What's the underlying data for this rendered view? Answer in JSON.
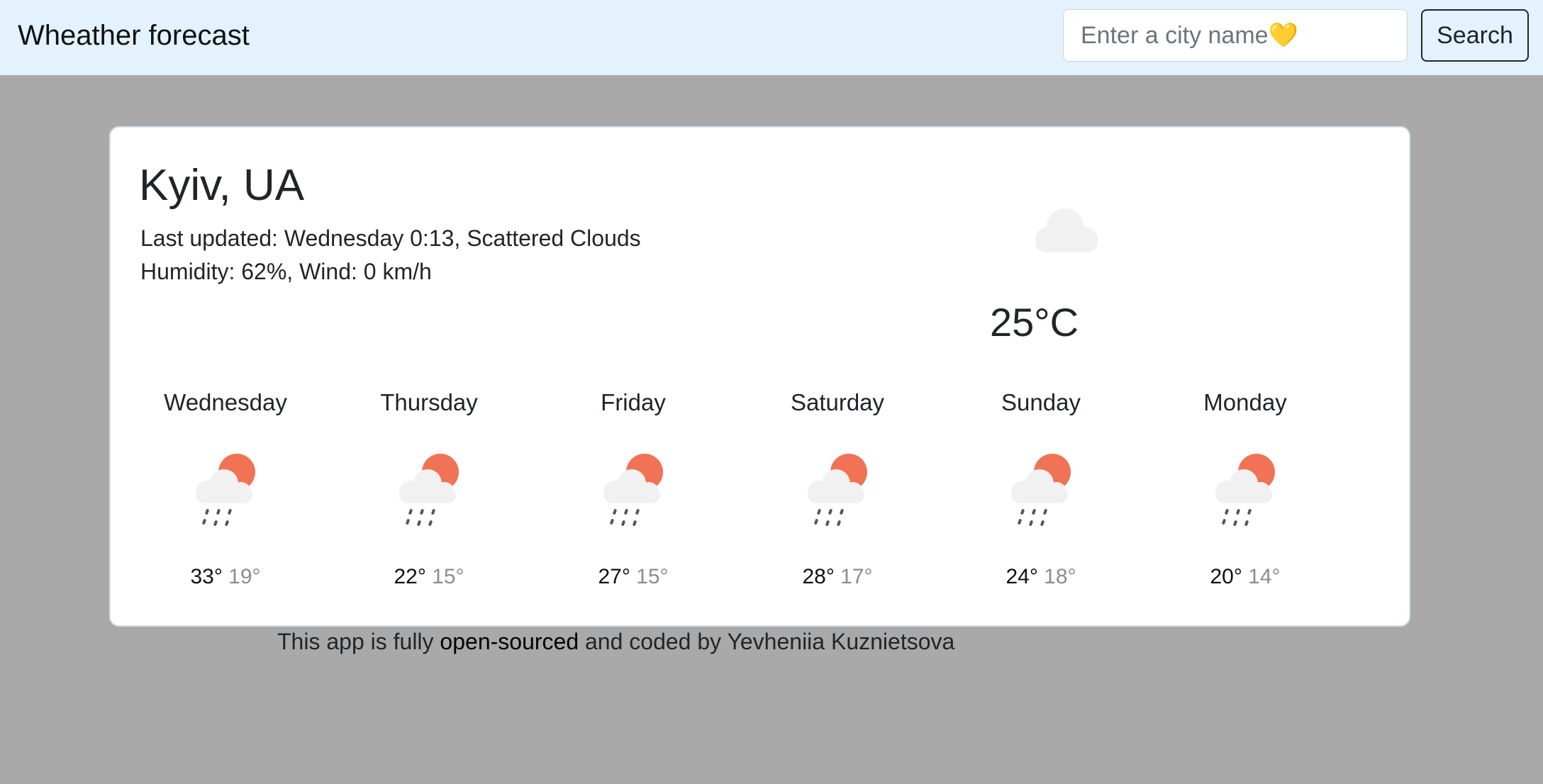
{
  "navbar": {
    "brand": "Wheather forecast",
    "search_placeholder": "Enter a city name💛",
    "search_value": "",
    "search_button": "Search"
  },
  "current": {
    "city": "Kyiv, UA",
    "last_updated_label": "Last updated:",
    "last_updated": "Wednesday 0:13",
    "description": "Scattered Clouds",
    "humidity_label": "Humidity:",
    "humidity": "62%",
    "wind_label": "Wind:",
    "wind": "0 km/h",
    "temperature": "25°C",
    "icon": "cloud-icon"
  },
  "forecast": [
    {
      "day": "Wednesday",
      "max": "33°",
      "min": "19°",
      "icon": "rain-sun-icon"
    },
    {
      "day": "Thursday",
      "max": "22°",
      "min": "15°",
      "icon": "rain-sun-icon"
    },
    {
      "day": "Friday",
      "max": "27°",
      "min": "15°",
      "icon": "rain-sun-icon"
    },
    {
      "day": "Saturday",
      "max": "28°",
      "min": "17°",
      "icon": "rain-sun-icon"
    },
    {
      "day": "Sunday",
      "max": "24°",
      "min": "18°",
      "icon": "rain-sun-icon"
    },
    {
      "day": "Monday",
      "max": "20°",
      "min": "14°",
      "icon": "rain-sun-icon"
    }
  ],
  "footer": {
    "prefix": "This app is fully",
    "link": "open-sourced",
    "suffix": "and coded by Yevheniia Kuznietsova"
  },
  "colors": {
    "background": "#a9a9a9",
    "navbar": "#e3f2fd",
    "sun": "#f07355",
    "cloud": "#f1f1f1"
  }
}
